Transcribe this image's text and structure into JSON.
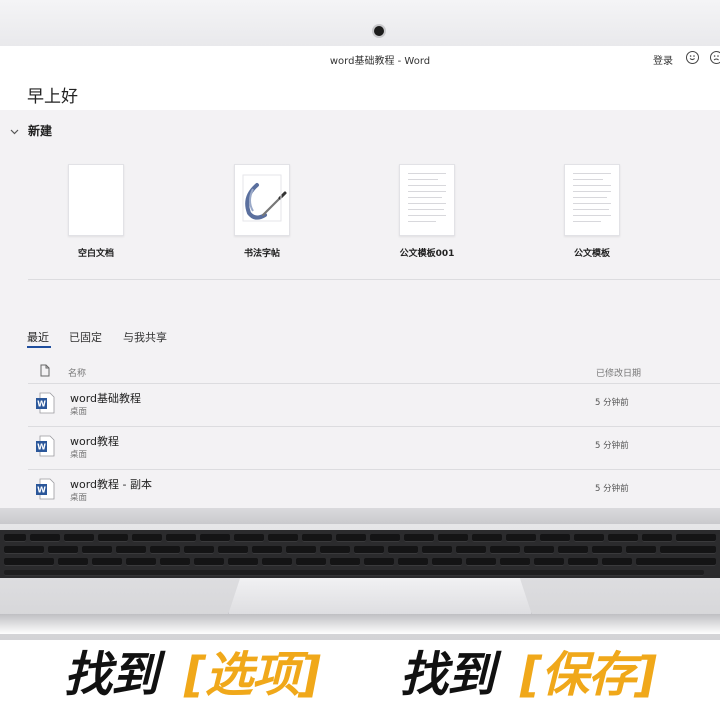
{
  "window": {
    "title": "word基础教程  -  Word",
    "signin": "登录"
  },
  "greeting": "早上好",
  "new_section": {
    "label": "新建",
    "templates": [
      {
        "label": "空白文档",
        "kind": "blank"
      },
      {
        "label": "书法字帖",
        "kind": "calligraphy"
      },
      {
        "label": "公文模板001",
        "kind": "lined"
      },
      {
        "label": "公文模板",
        "kind": "lined"
      }
    ]
  },
  "tabs": [
    {
      "label": "最近"
    },
    {
      "label": "已固定"
    },
    {
      "label": "与我共享"
    }
  ],
  "file_list": {
    "columns": {
      "name": "名称",
      "date": "已修改日期"
    },
    "rows": [
      {
        "name": "word基础教程",
        "location": "桌面",
        "modified": "5 分钟前"
      },
      {
        "name": "word教程",
        "location": "桌面",
        "modified": "5 分钟前"
      },
      {
        "name": "word教程 - 副本",
        "location": "桌面",
        "modified": "5 分钟前"
      }
    ]
  },
  "caption": {
    "part1": "找到",
    "part2": "[选项]",
    "part3": "找到",
    "part4": "[保存]"
  },
  "colors": {
    "accent": "#1f4e9e",
    "caption_gold": "#f0a81a",
    "word_blue": "#2b579a"
  },
  "icons": [
    "camera-icon",
    "smiley-icon",
    "frown-icon",
    "chevron-down-icon",
    "document-icon",
    "word-file-icon"
  ]
}
